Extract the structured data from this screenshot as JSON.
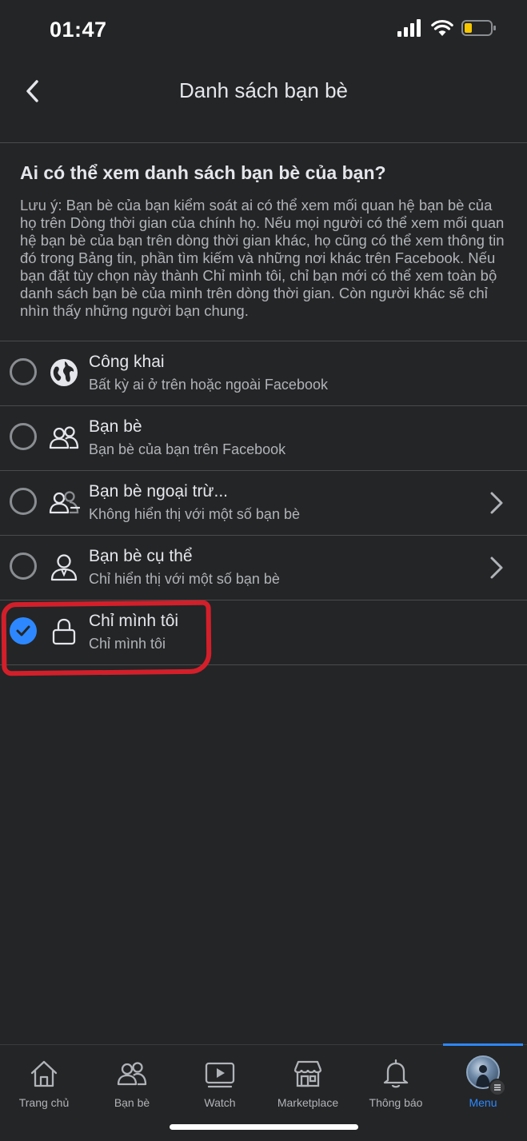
{
  "status_bar": {
    "time": "01:47"
  },
  "header": {
    "title": "Danh sách bạn bè"
  },
  "question": "Ai có thể xem danh sách bạn bè của bạn?",
  "note": "Lưu ý: Bạn bè của bạn kiểm soát ai có thể xem mối quan hệ bạn bè của họ trên Dòng thời gian của chính họ. Nếu mọi người có thể xem mối quan hệ bạn bè của bạn trên dòng thời gian khác, họ cũng có thể xem thông tin đó trong Bảng tin, phần tìm kiếm và những nơi khác trên Facebook. Nếu bạn đặt tùy chọn này thành Chỉ mình tôi, chỉ bạn mới có thể xem toàn bộ danh sách bạn bè của mình trên dòng thời gian. Còn người khác sẽ chỉ nhìn thấy những người bạn chung.",
  "options": [
    {
      "title": "Công khai",
      "subtitle": "Bất kỳ ai ở trên hoặc ngoài Facebook",
      "icon": "globe-icon",
      "selected": false,
      "has_chevron": false
    },
    {
      "title": "Bạn bè",
      "subtitle": "Bạn bè của bạn trên Facebook",
      "icon": "friends-icon",
      "selected": false,
      "has_chevron": false
    },
    {
      "title": "Bạn bè ngoại trừ...",
      "subtitle": "Không hiển thị với một số bạn bè",
      "icon": "friends-except-icon",
      "selected": false,
      "has_chevron": true
    },
    {
      "title": "Bạn bè cụ thể",
      "subtitle": "Chỉ hiển thị với một số bạn bè",
      "icon": "specific-friend-icon",
      "selected": false,
      "has_chevron": true
    },
    {
      "title": "Chỉ mình tôi",
      "subtitle": "Chỉ mình tôi",
      "icon": "lock-icon",
      "selected": true,
      "has_chevron": false
    }
  ],
  "tabs": [
    {
      "label": "Trang chủ",
      "icon": "home-icon",
      "active": false
    },
    {
      "label": "Bạn bè",
      "icon": "friends-icon",
      "active": false
    },
    {
      "label": "Watch",
      "icon": "watch-icon",
      "active": false
    },
    {
      "label": "Marketplace",
      "icon": "marketplace-icon",
      "active": false
    },
    {
      "label": "Thông báo",
      "icon": "bell-icon",
      "active": false
    },
    {
      "label": "Menu",
      "icon": "avatar",
      "active": true
    }
  ],
  "colors": {
    "background": "#242526",
    "accent": "#2d88ff",
    "highlight": "#d31f2a",
    "text_primary": "#e4e6eb",
    "text_secondary": "#b0b3b8"
  }
}
